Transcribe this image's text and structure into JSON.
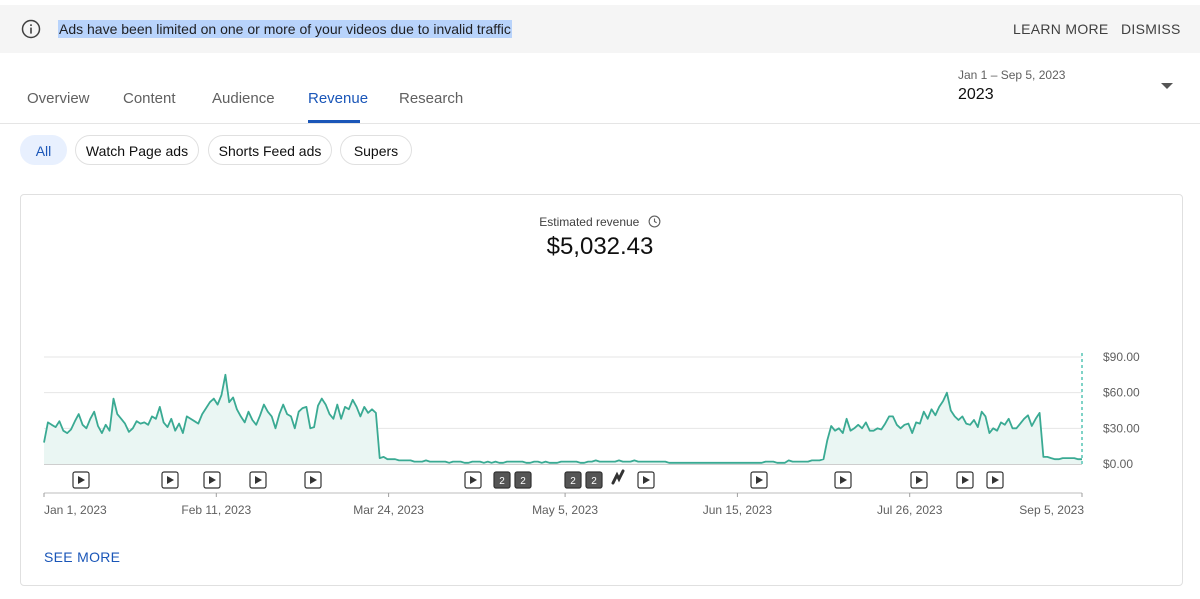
{
  "banner": {
    "message": "Ads have been limited on one or more of your videos due to invalid traffic",
    "learn_more": "LEARN MORE",
    "dismiss": "DISMISS",
    "icon": "info-icon"
  },
  "tabs": [
    {
      "label": "Overview",
      "active": false
    },
    {
      "label": "Content",
      "active": false
    },
    {
      "label": "Audience",
      "active": false
    },
    {
      "label": "Revenue",
      "active": true
    },
    {
      "label": "Research",
      "active": false
    }
  ],
  "date_picker": {
    "range": "Jan 1 – Sep 5, 2023",
    "value": "2023"
  },
  "chips": [
    {
      "label": "All",
      "active": true
    },
    {
      "label": "Watch Page ads",
      "active": false
    },
    {
      "label": "Shorts Feed ads",
      "active": false
    },
    {
      "label": "Supers",
      "active": false
    }
  ],
  "metric": {
    "label": "Estimated revenue",
    "value": "$5,032.43"
  },
  "see_more": "SEE MORE",
  "colors": {
    "accent": "#1a56b8",
    "line": "#3aaa93",
    "fill": "#eaf6f3",
    "chip_active": "#e8f0fe",
    "banner_highlight": "#b8d3fb"
  },
  "chart_data": {
    "type": "area",
    "y_tick_labels": [
      "$90.00",
      "$60.00",
      "$30.00",
      "$0.00"
    ],
    "y_ticks": [
      90,
      60,
      30,
      0
    ],
    "ylim": [
      0,
      90
    ],
    "x_start": "2023-01-01",
    "x_end": "2023-09-05",
    "x_tick_labels": [
      {
        "date": "2023-01-01",
        "label": "Jan 1, 2023"
      },
      {
        "date": "2023-02-11",
        "label": "Feb 11, 2023"
      },
      {
        "date": "2023-03-24",
        "label": "Mar 24, 2023"
      },
      {
        "date": "2023-05-05",
        "label": "May 5, 2023"
      },
      {
        "date": "2023-06-15",
        "label": "Jun 15, 2023"
      },
      {
        "date": "2023-07-26",
        "label": "Jul 26, 2023"
      },
      {
        "date": "2023-09-05",
        "label": "Sep 5, 2023"
      }
    ],
    "grid": true,
    "series": [
      {
        "values": [
          18,
          35,
          33,
          31,
          36,
          28,
          26,
          29,
          36,
          42,
          33,
          30,
          38,
          44,
          32,
          26,
          33,
          28,
          55,
          42,
          38,
          34,
          27,
          30,
          36,
          34,
          35,
          33,
          40,
          38,
          48,
          35,
          31,
          38,
          28,
          34,
          26,
          40,
          38,
          36,
          34,
          42,
          47,
          52,
          55,
          50,
          58,
          75,
          52,
          56,
          46,
          40,
          35,
          44,
          37,
          33,
          41,
          50,
          44,
          40,
          30,
          42,
          50,
          42,
          40,
          30,
          44,
          47,
          48,
          30,
          31,
          49,
          55,
          50,
          42,
          38,
          50,
          38,
          48,
          46,
          54,
          48,
          40,
          48,
          43,
          46,
          43,
          5,
          6,
          4,
          4,
          4,
          3,
          3,
          3,
          3,
          2,
          2,
          2,
          3,
          2,
          2,
          2,
          2,
          2,
          1,
          2,
          2,
          2,
          1,
          1,
          2,
          2,
          2,
          1,
          2,
          1,
          2,
          1,
          1,
          2,
          2,
          2,
          2,
          2,
          1,
          1,
          2,
          2,
          1,
          2,
          1,
          1,
          1,
          2,
          2,
          2,
          2,
          2,
          1,
          1,
          2,
          2,
          3,
          2,
          2,
          2,
          2,
          2,
          3,
          2,
          2,
          2,
          3,
          2,
          2,
          2,
          2,
          2,
          2,
          2,
          2,
          1,
          1,
          1,
          1,
          1,
          1,
          1,
          1,
          1,
          1,
          1,
          1,
          1,
          1,
          1,
          1,
          1,
          1,
          1,
          1,
          1,
          1,
          1,
          1,
          1,
          2,
          2,
          2,
          1,
          1,
          1,
          3,
          2,
          2,
          2,
          2,
          2,
          3,
          3,
          3,
          4,
          20,
          32,
          28,
          30,
          26,
          38,
          28,
          30,
          33,
          30,
          35,
          28,
          28,
          30,
          29,
          34,
          40,
          40,
          33,
          30,
          33,
          34,
          26,
          35,
          34,
          44,
          38,
          46,
          41,
          48,
          53,
          60,
          45,
          40,
          37,
          40,
          34,
          33,
          37,
          31,
          44,
          40,
          26,
          30,
          28,
          35,
          33,
          38,
          30,
          30,
          34,
          38,
          41,
          32,
          38,
          43,
          6,
          6,
          5,
          4,
          4,
          5,
          5,
          5,
          5,
          4,
          4
        ]
      }
    ],
    "video_markers": [
      "play",
      "play",
      "play",
      "play",
      "play",
      "play",
      "2",
      "2",
      "2",
      "2",
      "short",
      "play",
      "play",
      "play",
      "play",
      "play",
      "play",
      "play"
    ]
  }
}
